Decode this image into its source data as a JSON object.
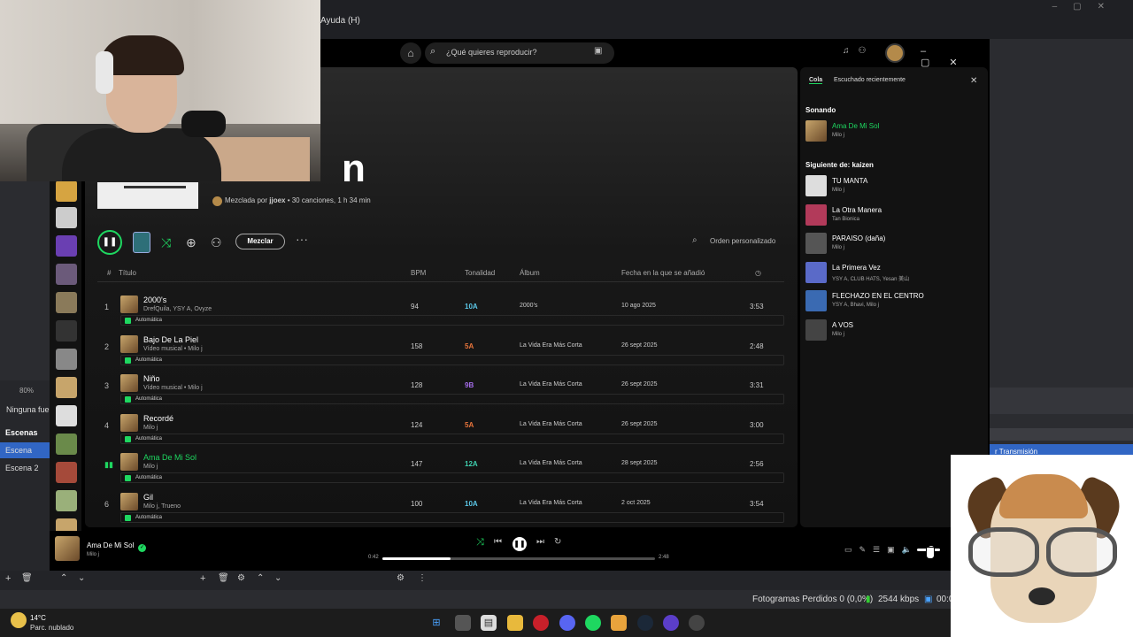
{
  "obs": {
    "menu_help": "Ayuda (H)",
    "zoom": "80%",
    "source_status": "Ninguna fue",
    "scenes_header": "Escenas",
    "scenes": [
      "Escena",
      "Escena 2"
    ],
    "transmission_label": "r Transmisión",
    "dropped_frames": "Fotogramas Perdidos 0 (0,0%)",
    "bitrate": "2544 kbps",
    "time": "00:0"
  },
  "taskbar": {
    "temperature": "14°C",
    "weather": "Parc. nublado"
  },
  "spotify": {
    "search_placeholder": "¿Qué quieres reproducir?",
    "big_title": "n",
    "meta_text": "Mezclada por ",
    "meta_user": "jjoex",
    "meta_rest": " • 30 canciones, 1 h 34 min",
    "mix_label": "Mezclar",
    "sort_label": "Orden personalizado",
    "columns": {
      "num": "#",
      "title": "Título",
      "bpm": "BPM",
      "key": "Tonalidad",
      "album": "Álbum",
      "date": "Fecha en la que se añadió"
    },
    "auto_label": "Automática",
    "tracks": [
      {
        "num": "1",
        "title": "2000's",
        "sub": "DrefQuila, YSY A, Ovyze",
        "bpm": "94",
        "key": "10A",
        "key_color": "#5bc8e8",
        "album": "2000's",
        "date": "10 ago 2025",
        "duration": "3:53"
      },
      {
        "num": "2",
        "title": "Bajo De La Piel",
        "sub": "Vídeo musical • Milo j",
        "bpm": "158",
        "key": "5A",
        "key_color": "#e8743b",
        "album": "La Vida Era Más Corta",
        "date": "26 sept 2025",
        "duration": "2:48"
      },
      {
        "num": "3",
        "title": "Niño",
        "sub": "Vídeo musical • Milo j",
        "bpm": "128",
        "key": "9B",
        "key_color": "#a36be8",
        "album": "La Vida Era Más Corta",
        "date": "26 sept 2025",
        "duration": "3:31"
      },
      {
        "num": "4",
        "title": "Recordé",
        "sub": "Milo j",
        "bpm": "124",
        "key": "5A",
        "key_color": "#e8743b",
        "album": "La Vida Era Más Corta",
        "date": "26 sept 2025",
        "duration": "3:00"
      },
      {
        "num": "",
        "title": "Ama De Mi Sol",
        "sub": "Milo j",
        "bpm": "147",
        "key": "12A",
        "key_color": "#3fd1b0",
        "album": "La Vida Era Más Corta",
        "date": "28 sept 2025",
        "duration": "2:56"
      },
      {
        "num": "6",
        "title": "Gil",
        "sub": "Milo j, Trueno",
        "bpm": "100",
        "key": "10A",
        "key_color": "#5bc8e8",
        "album": "La Vida Era Más Corta",
        "date": "2 oct 2025",
        "duration": "3:54"
      }
    ],
    "queue": {
      "tab_queue": "Cola",
      "tab_recent": "Escuchado recientemente",
      "now_playing_header": "Sonando",
      "now_playing": {
        "title": "Ama De Mi Sol",
        "artist": "Milo j"
      },
      "next_header": "Siguiente de: kaizen",
      "items": [
        {
          "title": "TU MANTA",
          "artist": "Milo j"
        },
        {
          "title": "La Otra Manera",
          "artist": "Tan Bionica"
        },
        {
          "title": "PARAISO (daña)",
          "artist": "Milo j"
        },
        {
          "title": "La Primera Vez",
          "artist": "YSY A, CLUB HATS, Yesan 美山"
        },
        {
          "title": "FLECHAZO EN EL CENTRO",
          "artist": "YSY A, Bhavi, Milo j"
        },
        {
          "title": "A VOS",
          "artist": "Milo j"
        }
      ]
    },
    "player": {
      "title": "Ama De Mi Sol",
      "artist": "Milo j",
      "current_time": "0:42",
      "total_time": "2:48",
      "progress": 0.25
    }
  }
}
